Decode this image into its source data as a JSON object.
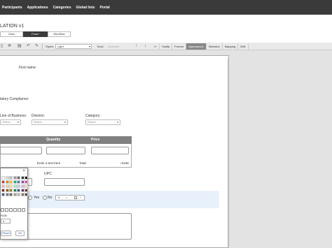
{
  "nav": {
    "items": [
      "Participants",
      "Applications",
      "Categories",
      "Global lists",
      "Portal"
    ]
  },
  "page": {
    "title": "LATION v1"
  },
  "view_tabs": [
    {
      "label": "Data",
      "active": false
    },
    {
      "label": "Form*",
      "active": true
    },
    {
      "label": "Workflow",
      "active": false
    }
  ],
  "toolbar": {
    "styles_label": "Styles:",
    "styles_value": "Light",
    "tools_label": "Tools:",
    "tools_value": "Undelete",
    "h_label": "H",
    "tabs": [
      "Tooltip",
      "Format",
      "Appearance",
      "Behavior",
      "Mapping",
      "XML"
    ],
    "active_tab": "Appearance"
  },
  "form": {
    "first_name_label": "First name:",
    "compliance_label": "latory Compliance:",
    "line_of_business_label": "Line of Business:",
    "division_label": "Division:",
    "category_label": "Category:",
    "select_placeholder": "Select...",
    "table": {
      "columns": [
        "Quantity",
        "Price"
      ],
      "footer_text": "Enter a text here",
      "total_label": "Total:",
      "sum_label": "=SUM"
    },
    "upc_label": "UPC:",
    "yes_label": "Yes",
    "no_label": "No",
    "mini_fields": [
      "3",
      "a"
    ]
  },
  "color_picker": {
    "close": "×",
    "swatches": [
      "#ffffff",
      "#dddddd",
      "#c0c0c0",
      "#999999",
      "#666666",
      "#333333",
      "#000000",
      "#c0392b",
      "#e67e22",
      "#f1c40f",
      "#27ae60",
      "#2980b9",
      "#8e44ad",
      "#e84393",
      "#f5b7b1",
      "#fad7a0",
      "#f9e79f",
      "#abebc6",
      "#aed6f1",
      "#d2b4de",
      "#fadbd8",
      "#7b241c",
      "#935116",
      "#9a7d0a",
      "#1e8449",
      "#1f618d",
      "#5b2c6f",
      "#78281f",
      "#3b5998",
      "#607d8b",
      "#795548",
      "#9e9e9e",
      "#bdbdbd",
      "#8d6e63",
      "#5d4037"
    ],
    "label": "RGB:",
    "value_text": "a",
    "reset_label": "Reset",
    "ok_label": "Ok"
  }
}
